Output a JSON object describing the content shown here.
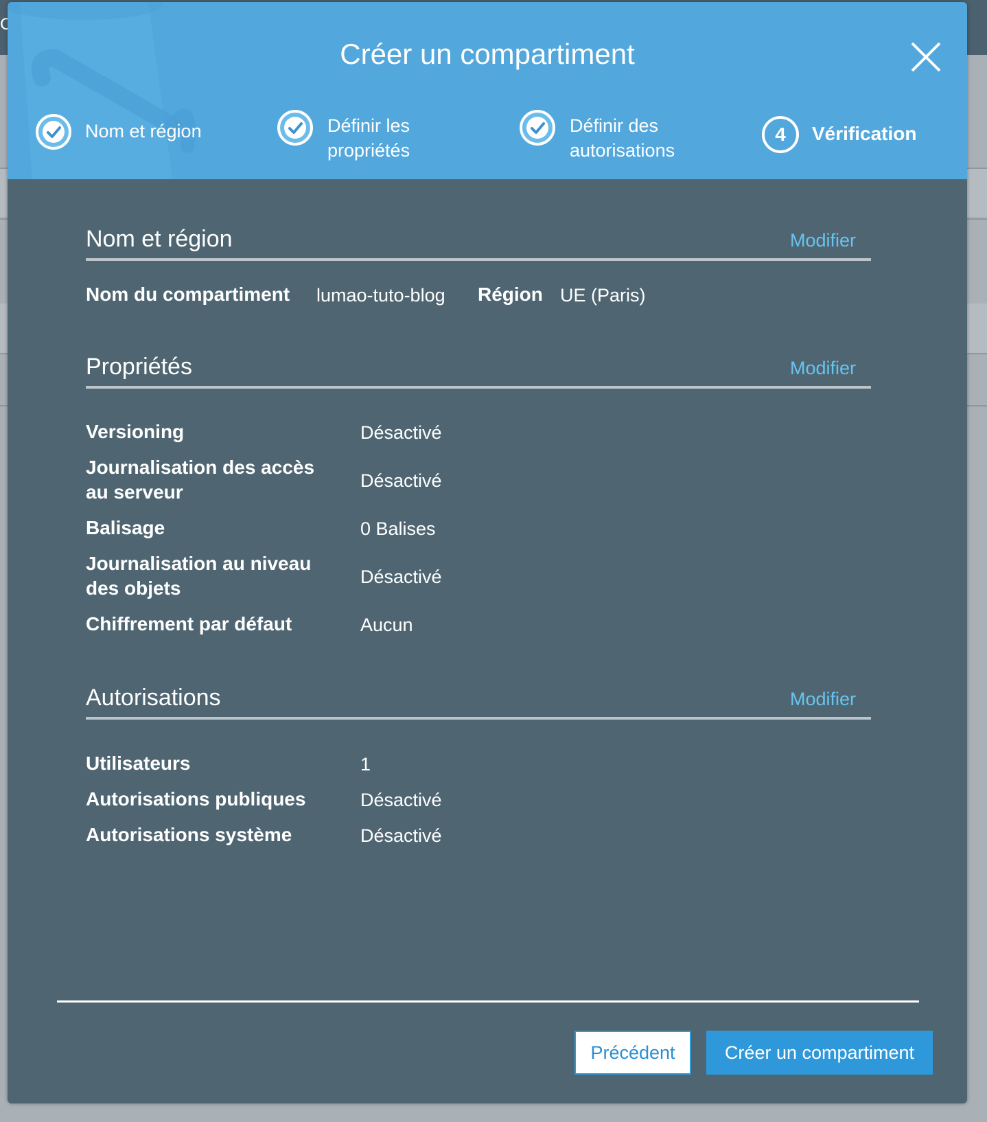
{
  "background": {
    "topbar_text": "C"
  },
  "dialog": {
    "title": "Créer un compartiment",
    "steps": [
      {
        "label_line1": "Nom et région",
        "label_line2": "",
        "status": "done"
      },
      {
        "label_line1": "Définir les",
        "label_line2": "propriétés",
        "status": "done"
      },
      {
        "label_line1": "Définir des",
        "label_line2": "autorisations",
        "status": "done"
      },
      {
        "number": "4",
        "label_line1": "Vérification",
        "label_line2": "",
        "status": "active"
      }
    ]
  },
  "section_name_region": {
    "title": "Nom et région",
    "modify": "Modifier",
    "bucket_name_label": "Nom du compartiment",
    "bucket_name_value": "lumao-tuto-blog",
    "region_label": "Région",
    "region_value": "UE (Paris)"
  },
  "section_properties": {
    "title": "Propriétés",
    "modify": "Modifier",
    "rows": [
      {
        "label": "Versioning",
        "value": "Désactivé"
      },
      {
        "label_line1": "Journalisation des accès",
        "label_line2": "au serveur",
        "value": "Désactivé"
      },
      {
        "label": "Balisage",
        "value": "0 Balises"
      },
      {
        "label_line1": "Journalisation au niveau",
        "label_line2": "des objets",
        "value": "Désactivé"
      },
      {
        "label": "Chiffrement par défaut",
        "value": "Aucun"
      }
    ]
  },
  "section_permissions": {
    "title": "Autorisations",
    "modify": "Modifier",
    "rows": [
      {
        "label": "Utilisateurs",
        "value": "1"
      },
      {
        "label": "Autorisations publiques",
        "value": "Désactivé"
      },
      {
        "label": "Autorisations système",
        "value": "Désactivé"
      }
    ]
  },
  "footer": {
    "previous_label": "Précédent",
    "create_label": "Créer un compartiment"
  },
  "colors": {
    "header_bg": "#52a7dc",
    "body_bg": "#4f6672",
    "link": "#67c4ef",
    "primary_button": "#2f98db"
  },
  "icons": {
    "step_done": "check-circle-icon",
    "close": "close-icon",
    "header_decoration": "bucket-illustration"
  }
}
